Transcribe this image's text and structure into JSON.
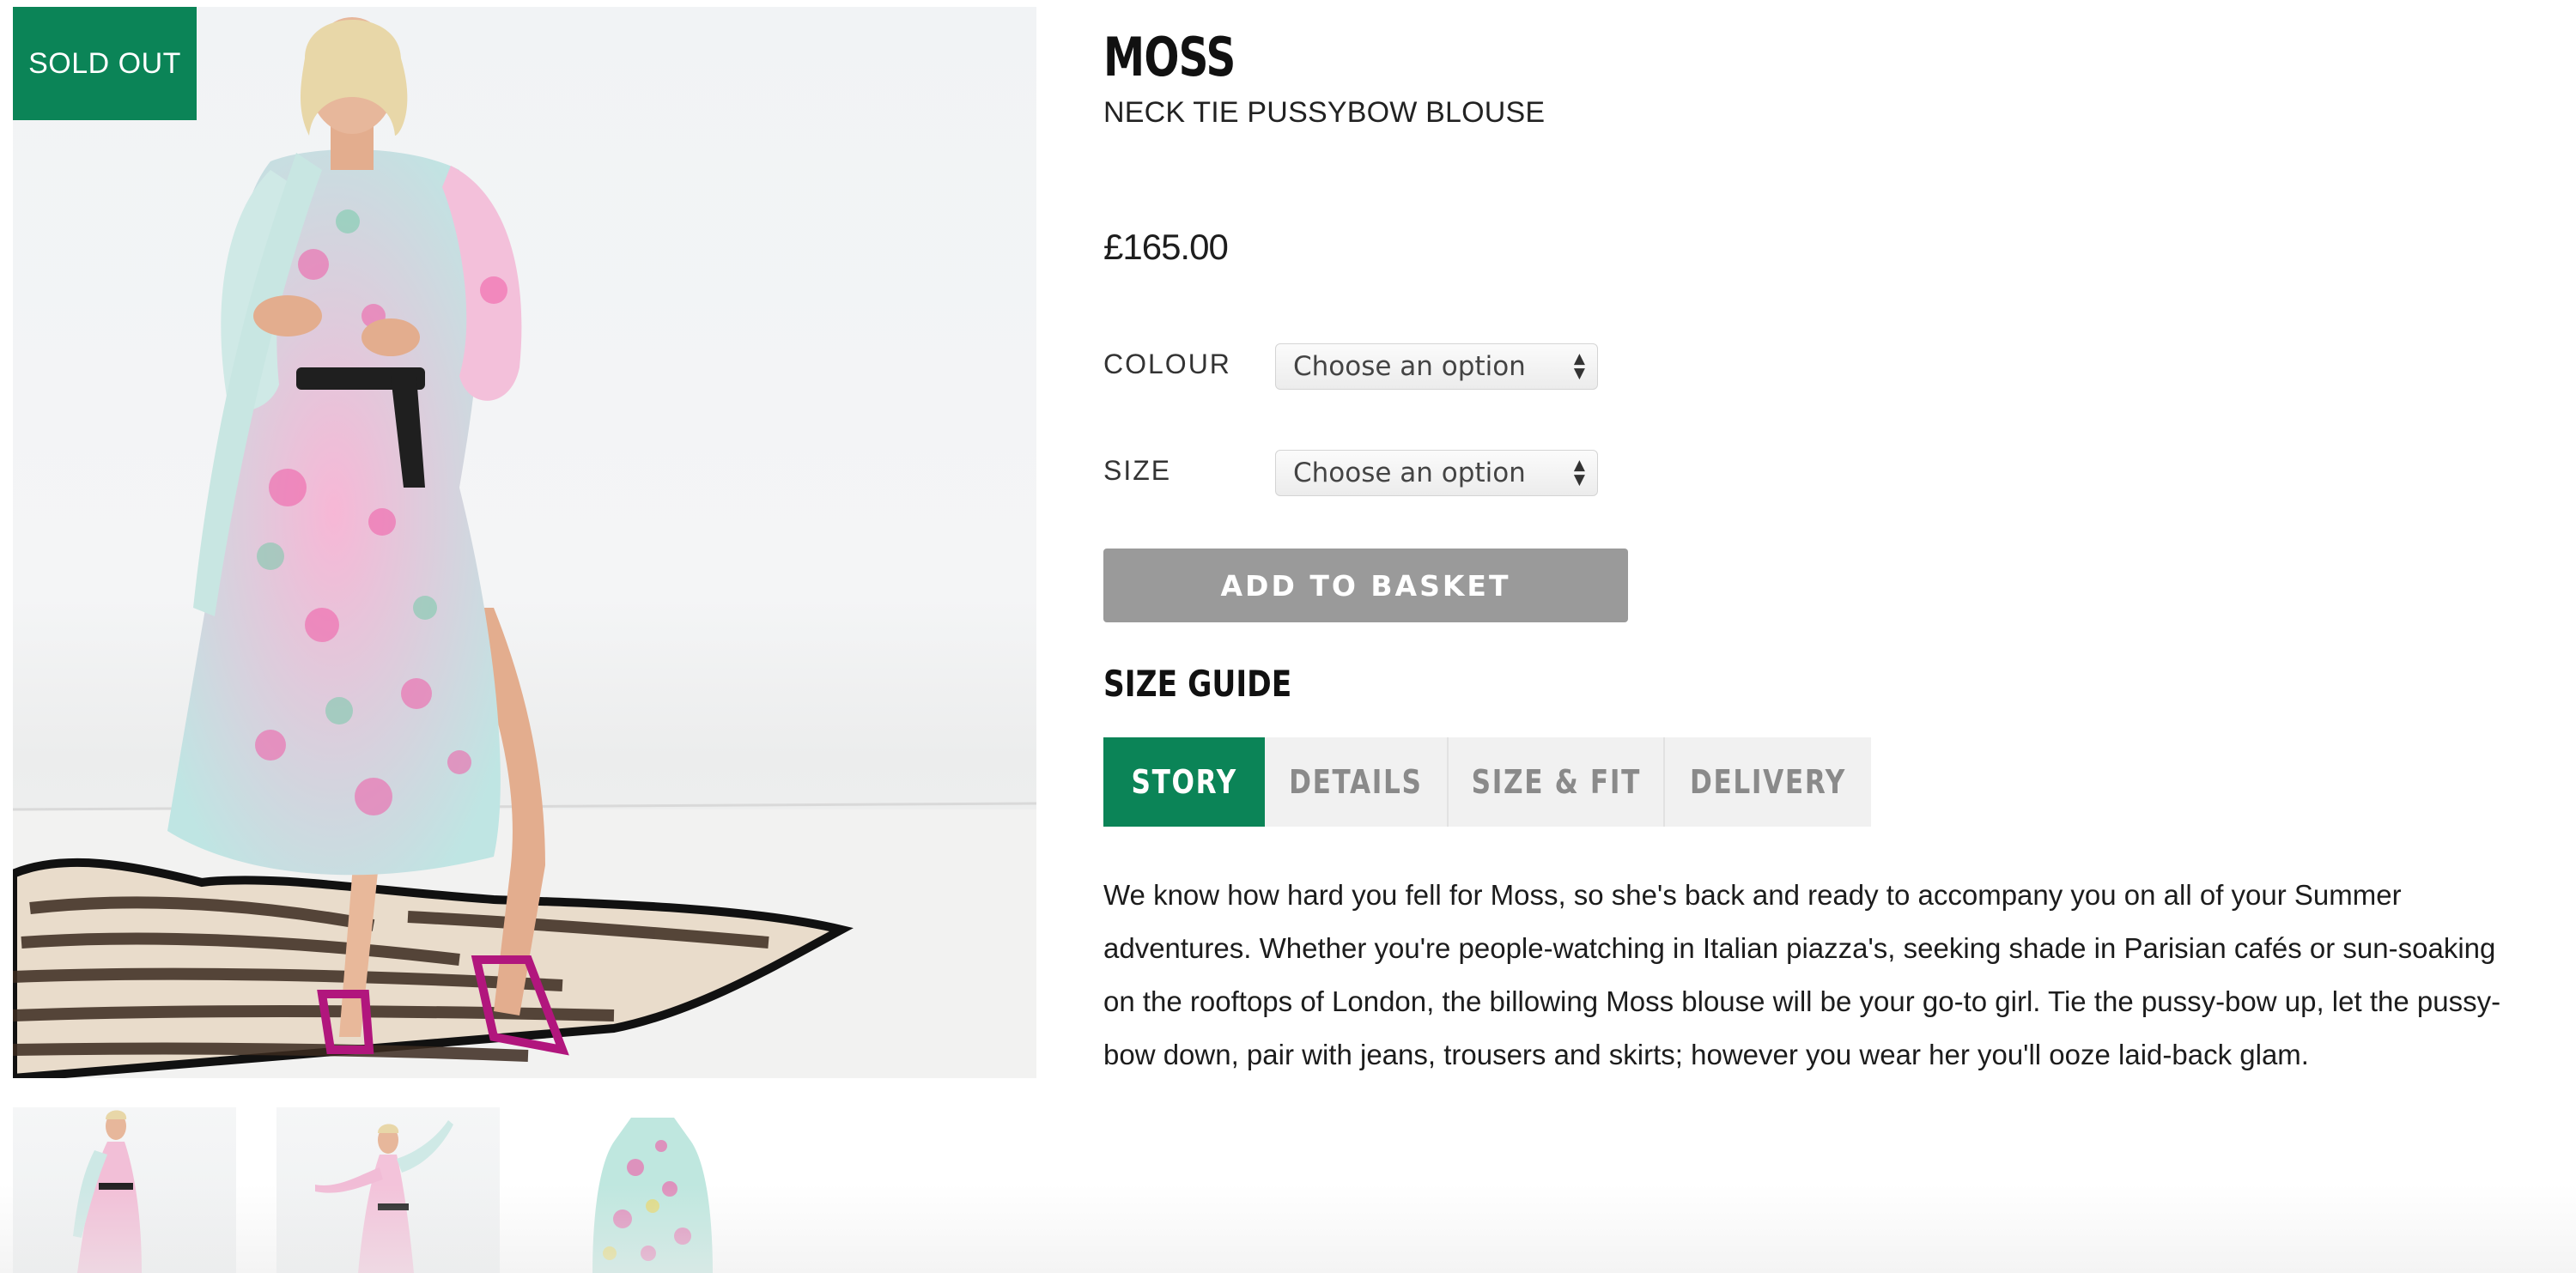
{
  "gallery": {
    "badge": "SOLD OUT",
    "main_image": "model wearing floral pussybow blouse and skirt",
    "thumbnails": [
      "front view",
      "arms raised view",
      "flat blouse view"
    ]
  },
  "product": {
    "name": "MOSS",
    "subtitle": "NECK TIE PUSSYBOW BLOUSE",
    "price": "£165.00"
  },
  "options": {
    "colour_label": "COLOUR",
    "colour_value": "Choose an option",
    "size_label": "SIZE",
    "size_value": "Choose an option"
  },
  "actions": {
    "add_to_basket": "ADD TO BASKET",
    "size_guide": "SIZE GUIDE"
  },
  "tabs": [
    {
      "label": "STORY",
      "active": true
    },
    {
      "label": "DETAILS",
      "active": false
    },
    {
      "label": "SIZE & FIT",
      "active": false
    },
    {
      "label": "DELIVERY",
      "active": false
    }
  ],
  "story": "We know how hard you fell for Moss, so she's back and ready to accompany you on all of your Summer adventures. Whether you're people-watching in Italian piazza's, seeking shade in Parisian cafés or sun-soaking on the rooftops of London, the billowing Moss blouse will be your go-to girl. Tie the pussy-bow up, let the pussy-bow down, pair with jeans, trousers and skirts; however you wear her you'll ooze laid-back glam.",
  "colors": {
    "accent": "#0b8457",
    "button": "#9a9a9a",
    "tab_inactive_bg": "#f1f1f1"
  }
}
